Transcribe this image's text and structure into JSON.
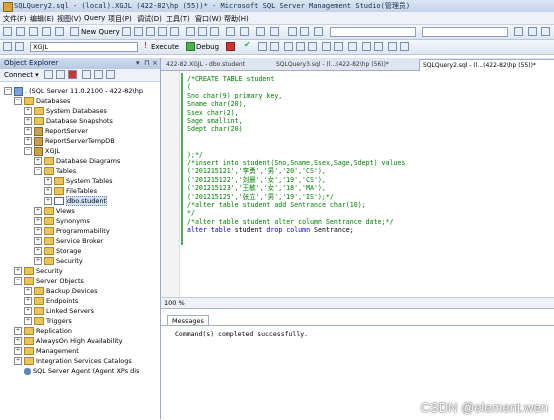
{
  "window": {
    "title": "SQLQuery2.sql - (local).XGJL (422-82\\hp (55))* - Microsoft SQL Server Management Studio(管理员)"
  },
  "menu": [
    "文件(F)",
    "编辑(E)",
    "视图(V)",
    "Query",
    "项目(P)",
    "调试(D)",
    "工具(T)",
    "窗口(W)",
    "帮助(H)"
  ],
  "toolbar1": {
    "new_query": "New Query"
  },
  "toolbar2": {
    "database": "XGJL",
    "execute": "Execute",
    "debug": "Debug"
  },
  "object_explorer": {
    "title": "Object Explorer",
    "connect": "Connect ▾",
    "nodes": {
      "server": ". (SQL Server 11.0.2100 - 422-82\\hp",
      "databases": "Databases",
      "system_databases": "System Databases",
      "snapshots": "Database Snapshots",
      "reportserver": "ReportServer",
      "reportservertempdb": "ReportServerTempDB",
      "xgjl": "XGJL",
      "diagrams": "Database Diagrams",
      "tables": "Tables",
      "system_tables": "System Tables",
      "filetables": "FileTables",
      "dbo_student": "dbo.student",
      "views": "Views",
      "synonyms": "Synonyms",
      "programmability": "Programmability",
      "service_broker": "Service Broker",
      "storage": "Storage",
      "security_db": "Security",
      "security": "Security",
      "server_objects": "Server Objects",
      "backup_devices": "Backup Devices",
      "endpoints": "Endpoints",
      "linked_servers": "Linked Servers",
      "triggers": "Triggers",
      "replication": "Replication",
      "alwayson": "AlwaysOn High Availability",
      "management": "Management",
      "integration": "Integration Services Catalogs",
      "agent": "SQL Server Agent (Agent XPs dis"
    }
  },
  "tabs": [
    "422-82.XGJL - dbo.student",
    "SQLQuery3.sql - (l...(422-82\\hp (56))*",
    "SQLQuery2.sql - (l...(422-82\\hp (55))*"
  ],
  "editor": {
    "lines": [
      "/*CREATE TABLE student",
      "(",
      "Sno char(9) primary key,",
      "Sname char(20),",
      "Ssex char(2),",
      "Sage smallint,",
      "Sdept char(20)",
      "",
      ");*/",
      "/*insert into student(Sno,Sname,Ssex,Sage,Sdept) values",
      "('201215121','李勇','男','20','CS'),",
      "('201215122','刘晨','女','19','CS'),",
      "('201215123','王敏','女','18','MA'),",
      "('201215125','张立','男','19','IS');*/",
      "/*alter table student add Sentrance char(10);",
      "*/",
      "/*alter table student alter column Sentrance date;*/",
      "alter table student drop column Sentrance;"
    ],
    "last_line": {
      "kw1": "alter table",
      "ident1": " student ",
      "kw2": "drop column",
      "ident2": " Sentrance",
      "end": ";"
    }
  },
  "zoom": "100 %",
  "results": {
    "tab": "Messages",
    "message": "Command(s) completed successfully."
  },
  "watermark": "CSDN @element.wen"
}
